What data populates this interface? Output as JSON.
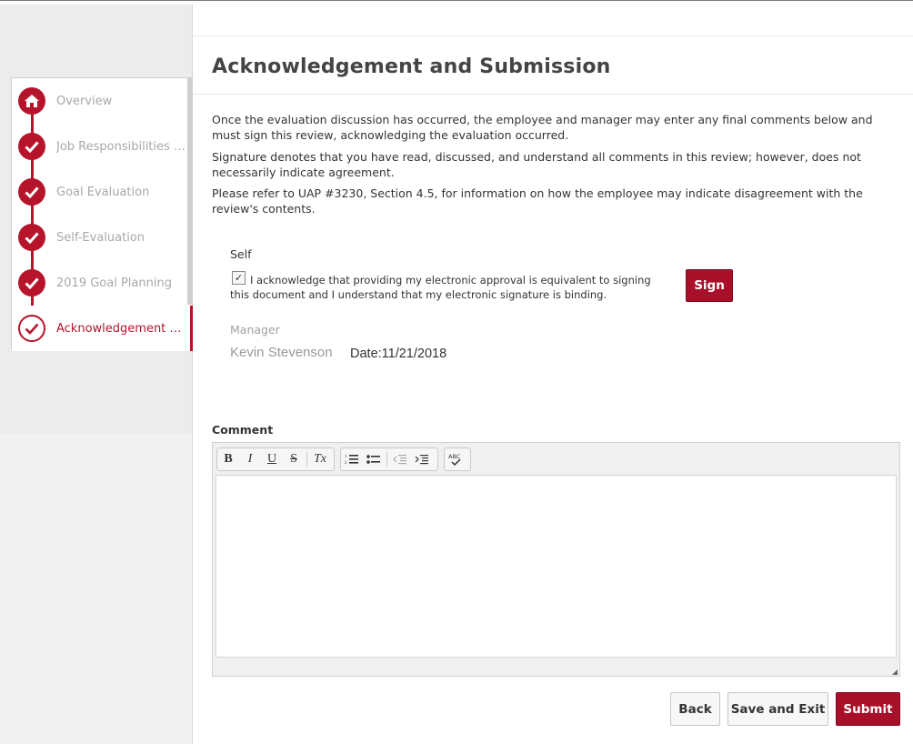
{
  "page": {
    "title": "Acknowledgement and Submission",
    "paragraphs": [
      "Once the evaluation discussion has occurred, the employee and manager may enter any final comments below and must sign this review, acknowledging the evaluation occurred.",
      "Signature denotes that you have read, discussed, and understand all comments in this review; however, does not necessarily indicate agreement.",
      "Please refer to UAP #3230, Section 4.5, for information on how the employee may indicate disagreement with the review's contents."
    ]
  },
  "sidebar": {
    "steps": [
      {
        "label": "Overview",
        "icon": "home-icon",
        "state": "home"
      },
      {
        "label": "Job Responsibilities Ev...",
        "icon": "checkmark-icon",
        "state": "complete"
      },
      {
        "label": "Goal Evaluation",
        "icon": "checkmark-icon",
        "state": "complete"
      },
      {
        "label": "Self-Evaluation",
        "icon": "checkmark-icon",
        "state": "complete"
      },
      {
        "label": "2019 Goal Planning",
        "icon": "checkmark-icon",
        "state": "complete"
      },
      {
        "label": "Acknowledgement and...",
        "icon": "checkmark-icon",
        "state": "active"
      }
    ]
  },
  "self": {
    "label": "Self",
    "checkbox_checked": true,
    "check_mark": "✓",
    "ack_text": "I acknowledge that providing my electronic approval is equivalent to signing this document and I understand that my electronic signature is binding.",
    "sign_label": "Sign"
  },
  "manager": {
    "label": "Manager",
    "name": "Kevin Stevenson",
    "date": "Date:11/21/2018"
  },
  "comment": {
    "label": "Comment",
    "toolbar": {
      "bold": "B",
      "italic": "I",
      "underline": "U",
      "strike": "S",
      "remove_format": "Tx",
      "numbered_list": "numbered-list-icon",
      "bulleted_list": "bulleted-list-icon",
      "outdent": "outdent-icon",
      "indent": "indent-icon",
      "spellcheck": "ABC"
    },
    "value": ""
  },
  "actions": {
    "back": "Back",
    "save_exit": "Save and Exit",
    "submit": "Submit"
  },
  "colors": {
    "accent": "#b5142b",
    "button_primary": "#a8102a",
    "muted_text": "#a8a8a8"
  }
}
